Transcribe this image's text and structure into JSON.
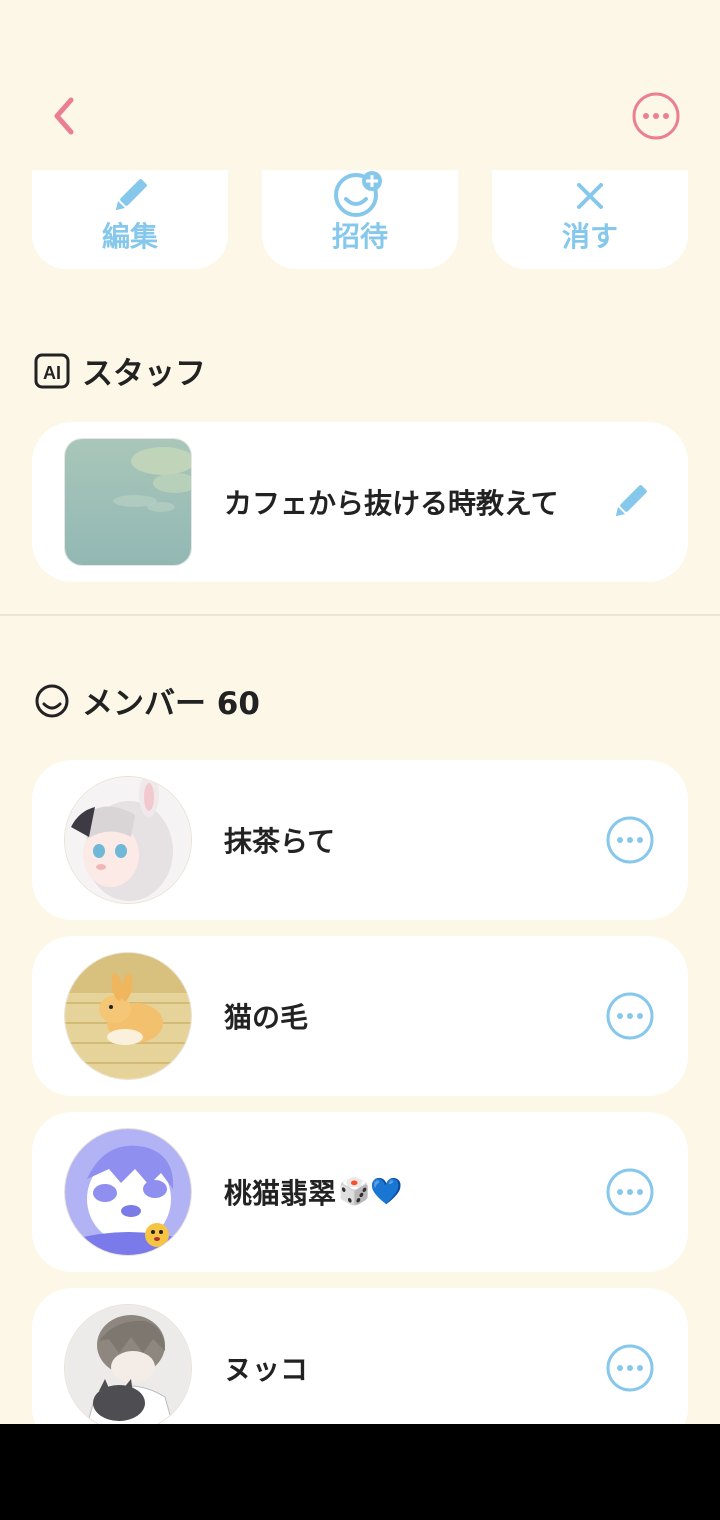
{
  "colors": {
    "background": "#fdf7e8",
    "card": "#ffffff",
    "accent_pink": "#ea7f90",
    "accent_blue": "#86c8ec",
    "text": "#222222"
  },
  "header": {
    "back_icon": "chevron-left-icon",
    "more_icon": "more-horizontal-circle-icon"
  },
  "actions": [
    {
      "label": "編集",
      "icon": "pencil-icon"
    },
    {
      "label": "招待",
      "icon": "add-smile-icon"
    },
    {
      "label": "消す",
      "icon": "close-icon"
    }
  ],
  "staff_section": {
    "title": "スタッフ",
    "icon": "ai-badge-icon",
    "item": {
      "name": "カフェから抜ける時教えて",
      "action_icon": "pencil-icon"
    }
  },
  "members_section": {
    "title": "メンバー 60",
    "icon": "smile-icon",
    "members": [
      {
        "name": "抹茶らて",
        "avatar": "anime-girl-avatar"
      },
      {
        "name": "猫の毛",
        "avatar": "rabbit-avatar"
      },
      {
        "name": "桃猫翡翠",
        "emoji": "🎲💙",
        "avatar": "purple-character-avatar"
      },
      {
        "name": "ヌッコ",
        "avatar": "boy-with-cat-avatar"
      }
    ]
  }
}
